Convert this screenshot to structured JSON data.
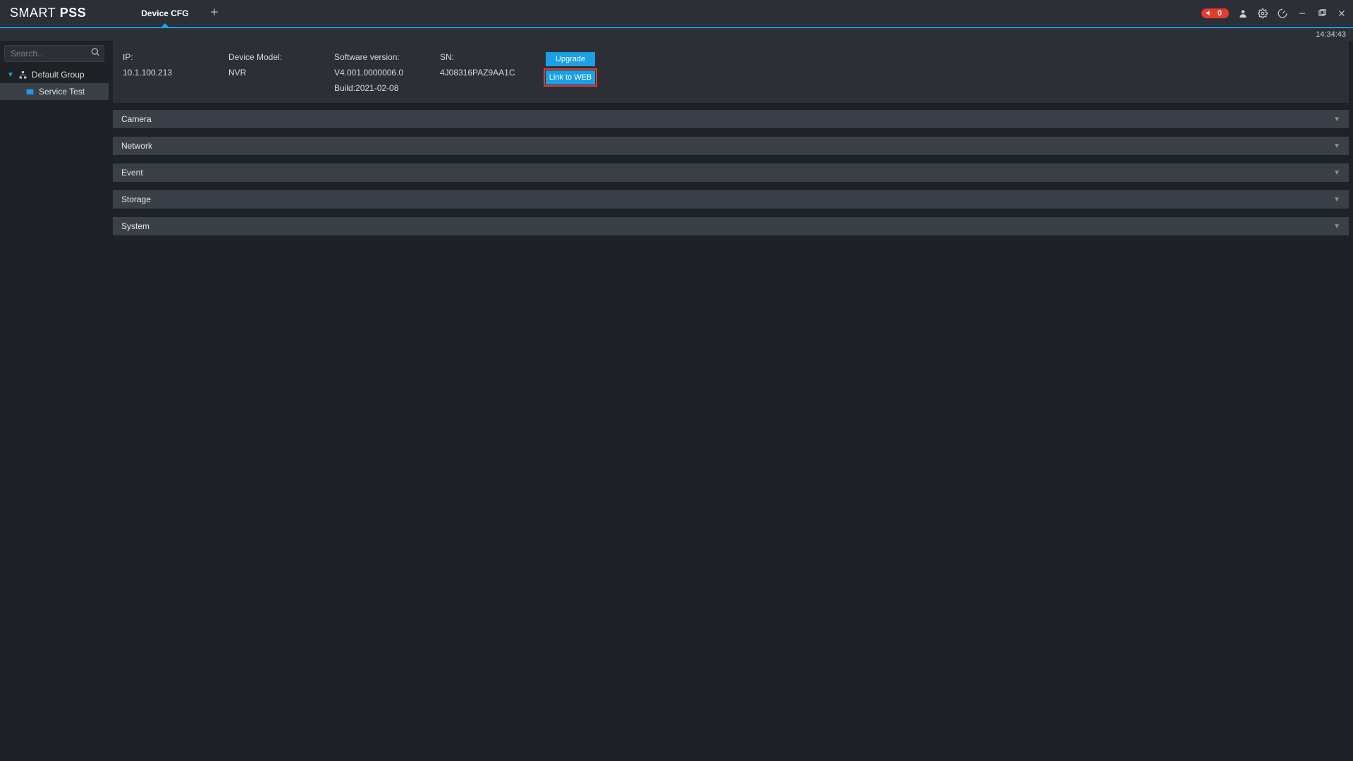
{
  "app": {
    "logo1": "SMART",
    "logo2": "PSS"
  },
  "tabs": {
    "active": "Device CFG"
  },
  "titlebar": {
    "alarm_count": "0",
    "clock": "14:34:43"
  },
  "sidebar": {
    "search_placeholder": "Search..",
    "group": "Default Group",
    "item": "Service Test"
  },
  "info": {
    "ip_label": "IP:",
    "ip_value": "10.1.100.213",
    "model_label": "Device Model:",
    "model_value": "NVR",
    "sw_label": "Software version:",
    "sw_value": "V4.001.0000006.0",
    "build_value": "Build:2021-02-08",
    "sn_label": "SN:",
    "sn_value": "4J08316PAZ9AA1C",
    "btn_upgrade": "Upgrade",
    "btn_link": "Link to WEB"
  },
  "sections": {
    "camera": "Camera",
    "network": "Network",
    "event": "Event",
    "storage": "Storage",
    "system": "System"
  }
}
